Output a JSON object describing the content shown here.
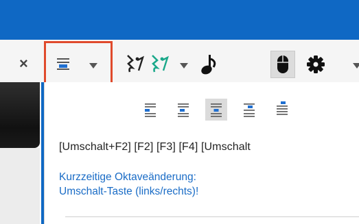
{
  "toolbar": {
    "close_glyph": "×",
    "alignment_tool": {
      "icon": "align-center-icon",
      "dropdown": "chevron-down-icon"
    },
    "rest_tool": {
      "icon": "rest-icon"
    },
    "rest_color_tool": {
      "icon": "rest-colored-icon",
      "dropdown": "chevron-down-icon"
    },
    "note_tool": {
      "icon": "note-icon"
    },
    "mouse_tool": {
      "icon": "mouse-icon"
    },
    "settings_tool": {
      "icon": "gear-icon",
      "dropdown": "chevron-down-icon"
    },
    "colors": {
      "highlight": "#e04a2c",
      "accent": "#0f68c4",
      "green": "#1aa88a"
    }
  },
  "panel": {
    "alignment_options": [
      {
        "icon": "align-left-icon"
      },
      {
        "icon": "align-left-indented-icon"
      },
      {
        "icon": "align-center-icon",
        "selected": true
      },
      {
        "icon": "align-right-indented-icon"
      },
      {
        "icon": "align-right-icon"
      }
    ],
    "shortcuts": "[Umschalt+F2]  [F2]  [F3]  [F4]  [Umschalt",
    "hint_line1": "Kurzzeitige Oktaveänderung:",
    "hint_line2": "Umschalt-Taste (links/rechts)!"
  }
}
